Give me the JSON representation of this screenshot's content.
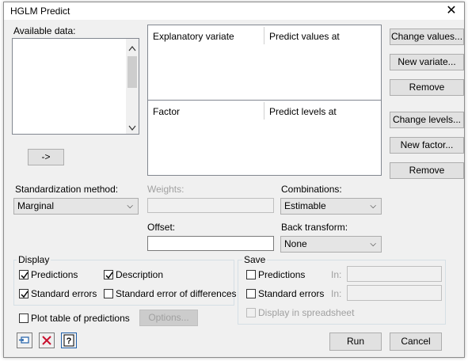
{
  "window": {
    "title": "HGLM Predict"
  },
  "available_data": {
    "label": "Available data:"
  },
  "buttons": {
    "arrow": "->",
    "change_values": "Change values...",
    "new_variate": "New variate...",
    "remove_variate": "Remove",
    "change_levels": "Change levels...",
    "new_factor": "New factor...",
    "remove_factor": "Remove",
    "options": "Options...",
    "run": "Run",
    "cancel": "Cancel"
  },
  "variate_grid": {
    "col1": "Explanatory variate",
    "col2": "Predict values at"
  },
  "factor_grid": {
    "col1": "Factor",
    "col2": "Predict levels at"
  },
  "standardization": {
    "label": "Standardization method:",
    "value": "Marginal"
  },
  "weights": {
    "label": "Weights:",
    "value": ""
  },
  "offset": {
    "label": "Offset:",
    "value": ""
  },
  "combinations": {
    "label": "Combinations:",
    "value": "Estimable"
  },
  "back_transform": {
    "label": "Back transform:",
    "value": "None"
  },
  "display": {
    "title": "Display",
    "predictions": {
      "label": "Predictions",
      "checked": true
    },
    "description": {
      "label": "Description",
      "checked": true
    },
    "standard_errors": {
      "label": "Standard errors",
      "checked": true
    },
    "sed": {
      "label": "Standard error of differences",
      "checked": false
    }
  },
  "save": {
    "title": "Save",
    "predictions": {
      "label": "Predictions",
      "in_label": "In:",
      "checked": false
    },
    "standard_errors": {
      "label": "Standard errors",
      "in_label": "In:",
      "checked": false
    },
    "spreadsheet": {
      "label": "Display in spreadsheet",
      "checked": false
    }
  },
  "plot": {
    "label": "Plot table of predictions",
    "checked": false
  }
}
